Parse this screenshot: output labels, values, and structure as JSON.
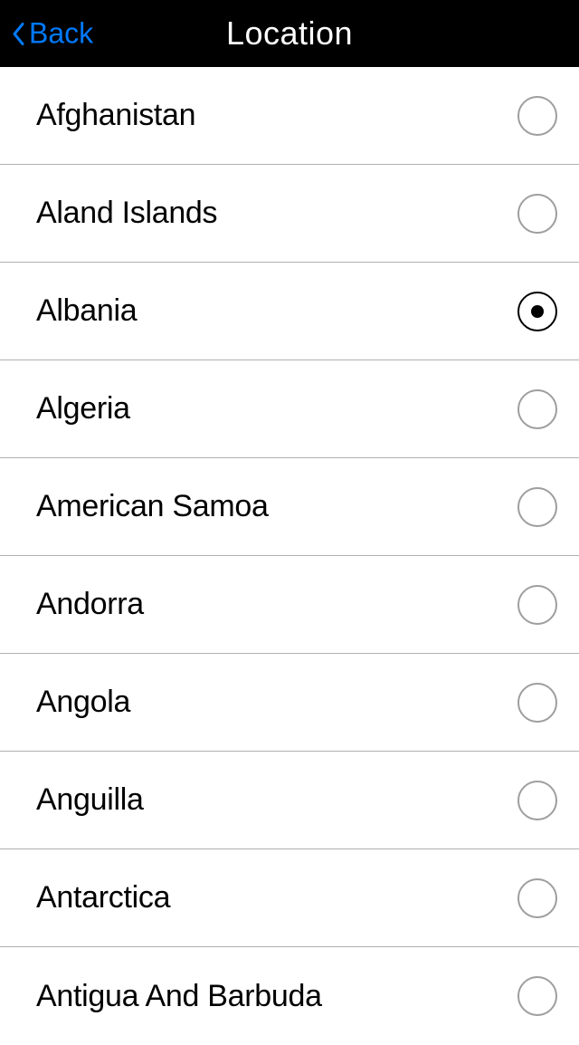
{
  "header": {
    "back_label": "Back",
    "title": "Location"
  },
  "locations": [
    {
      "name": "Afghanistan",
      "selected": false
    },
    {
      "name": "Aland Islands",
      "selected": false
    },
    {
      "name": "Albania",
      "selected": true
    },
    {
      "name": "Algeria",
      "selected": false
    },
    {
      "name": "American Samoa",
      "selected": false
    },
    {
      "name": "Andorra",
      "selected": false
    },
    {
      "name": "Angola",
      "selected": false
    },
    {
      "name": "Anguilla",
      "selected": false
    },
    {
      "name": "Antarctica",
      "selected": false
    },
    {
      "name": "Antigua And Barbuda",
      "selected": false
    }
  ]
}
